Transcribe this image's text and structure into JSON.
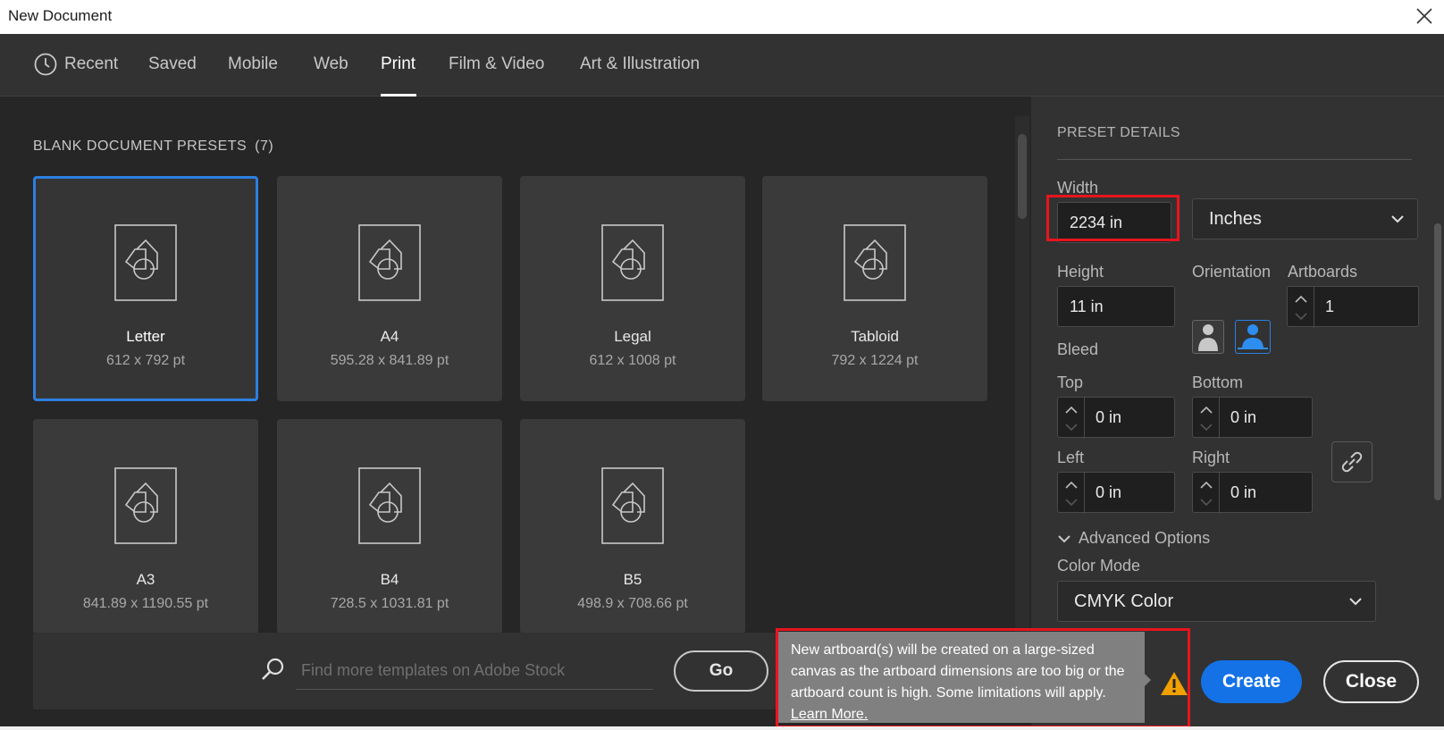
{
  "window": {
    "title": "New Document",
    "close_icon": "close-icon"
  },
  "tabs": [
    {
      "label": "Recent",
      "icon": "clock-icon"
    },
    {
      "label": "Saved"
    },
    {
      "label": "Mobile"
    },
    {
      "label": "Web"
    },
    {
      "label": "Print",
      "active": true
    },
    {
      "label": "Film & Video"
    },
    {
      "label": "Art & Illustration"
    }
  ],
  "presets": {
    "title": "BLANK DOCUMENT PRESETS",
    "count": "(7)",
    "items": [
      {
        "name": "Letter",
        "size": "612 x 792 pt",
        "selected": true
      },
      {
        "name": "A4",
        "size": "595.28 x 841.89 pt"
      },
      {
        "name": "Legal",
        "size": "612 x 1008 pt"
      },
      {
        "name": "Tabloid",
        "size": "792 x 1224 pt"
      },
      {
        "name": "A3",
        "size": "841.89 x 1190.55 pt"
      },
      {
        "name": "B4",
        "size": "728.5 x 1031.81 pt"
      },
      {
        "name": "B5",
        "size": "498.9 x 708.66 pt"
      }
    ]
  },
  "search": {
    "placeholder": "Find more templates on Adobe Stock",
    "go_label": "Go"
  },
  "details": {
    "header": "PRESET DETAILS",
    "width_label": "Width",
    "width_value": "2234 in",
    "units": "Inches",
    "height_label": "Height",
    "height_value": "11 in",
    "orientation_label": "Orientation",
    "artboards_label": "Artboards",
    "artboards_value": "1",
    "bleed_label": "Bleed",
    "top_label": "Top",
    "top_value": "0 in",
    "bottom_label": "Bottom",
    "bottom_value": "0 in",
    "left_label": "Left",
    "left_value": "0 in",
    "right_label": "Right",
    "right_value": "0 in",
    "advanced_label": "Advanced Options",
    "color_mode_label": "Color Mode",
    "color_mode_value": "CMYK Color"
  },
  "warning": {
    "message": "New artboard(s) will be created on a large-sized canvas as the artboard dimensions are too big or the artboard count is high. Some limitations will apply.",
    "learn_more": "Learn More."
  },
  "actions": {
    "create_label": "Create",
    "close_label": "Close"
  },
  "colors": {
    "accent": "#1472e6",
    "highlight": "#e8141e",
    "warning": "#f0a000"
  }
}
